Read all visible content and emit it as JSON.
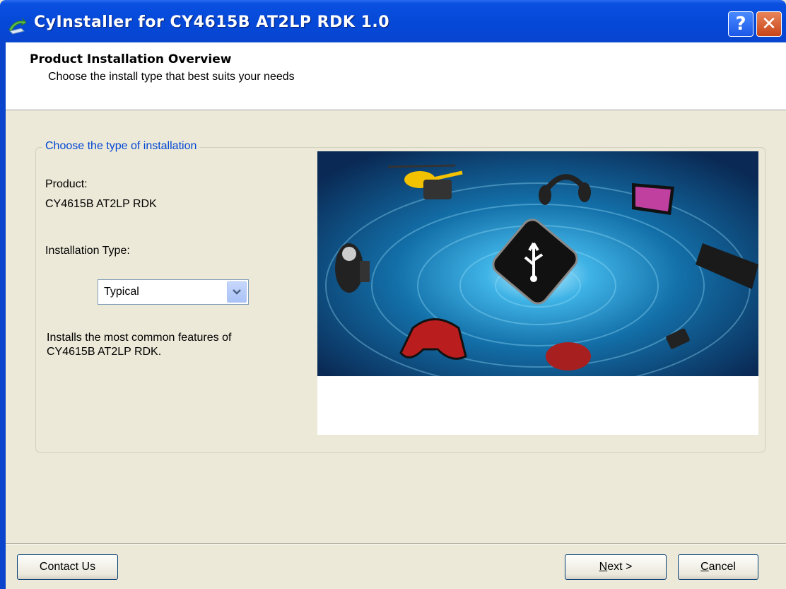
{
  "window": {
    "title": "CyInstaller for CY4615B AT2LP RDK 1.0",
    "help_glyph": "?",
    "close_glyph": "✕"
  },
  "header": {
    "title": "Product Installation Overview",
    "subtitle": "Choose the install type that best suits your needs"
  },
  "group": {
    "legend": "Choose the type of installation",
    "product_label": "Product:",
    "product_name": "CY4615B AT2LP RDK",
    "install_type_label": "Installation Type:",
    "install_type_value": "Typical",
    "description_line1": "Installs the most common features of",
    "description_line2": "CY4615B AT2LP RDK."
  },
  "buttons": {
    "contact": "Contact Us",
    "next_accel": "N",
    "next_rest": "ext >",
    "cancel_accel": "C",
    "cancel_rest": "ancel"
  },
  "colors": {
    "titlebar": "#0a50e0",
    "dialog_bg": "#ece9d8",
    "legend_text": "#0046d5"
  },
  "icons": [
    "app-installer-icon",
    "help-icon",
    "close-icon",
    "chevron-down-icon",
    "usb-icon"
  ]
}
